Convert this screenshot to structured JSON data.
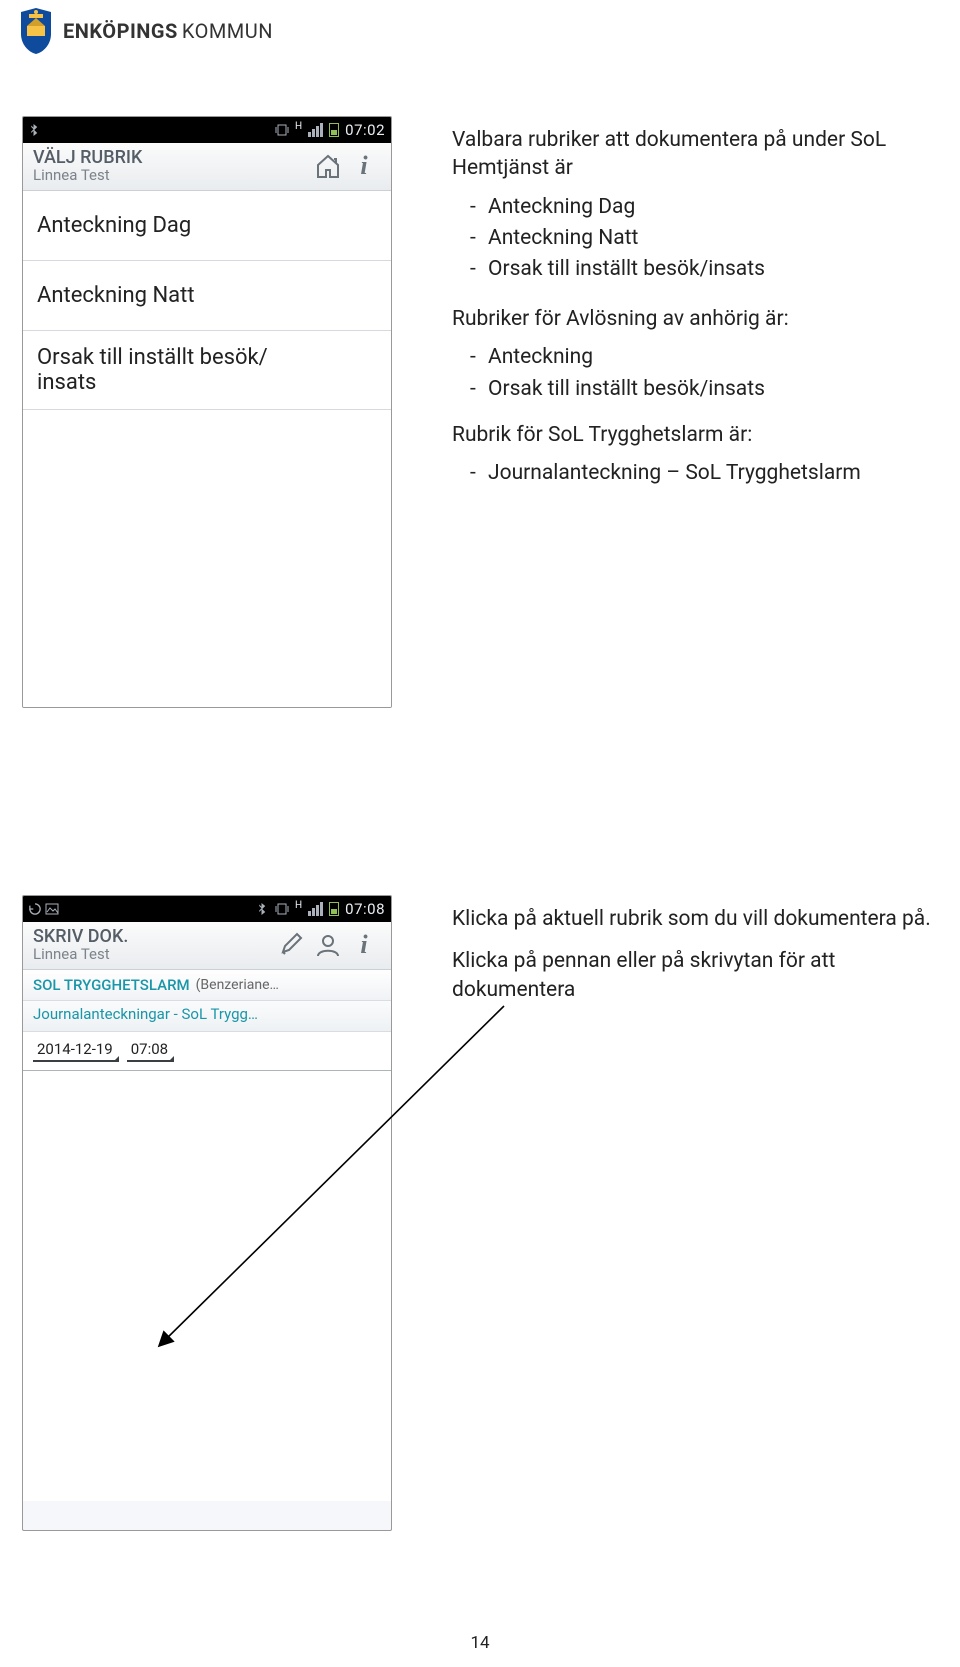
{
  "logo": {
    "text_first": "ENKÖPINGS",
    "text_second": "KOMMUN"
  },
  "phone1": {
    "status_time": "07:02",
    "net_label": "H",
    "title": "VÄLJ RUBRIK",
    "subtitle": "Linnea Test",
    "rows": {
      "r1": "Anteckning Dag",
      "r2": "Anteckning Natt",
      "r3a": "Orsak till inställt besök/",
      "r3b": "insats"
    }
  },
  "phone2": {
    "status_time": "07:08",
    "net_label": "H",
    "title": "SKRIV DOK.",
    "subtitle": "Linnea Test",
    "docname": "SOL TRYGGHETSLARM",
    "docparen": "(Benzeriane…",
    "docline": "Journalanteckningar - SoL Trygg…",
    "date": "2014-12-19",
    "time": "07:08"
  },
  "rtext1": {
    "head": "Valbara rubriker att dokumentera på under SoL Hemtjänst är",
    "items": [
      "Anteckning Dag",
      "Anteckning Natt",
      "Orsak till inställt besök/insats"
    ]
  },
  "rtext2": {
    "headA": "Rubriker för Avlösning av anhörig är:",
    "itemsA": [
      "Anteckning",
      "Orsak till inställt besök/insats"
    ],
    "headB": "Rubrik för SoL Trygghetslarm är:",
    "itemsB": [
      "Journalanteckning – SoL Trygghetslarm"
    ]
  },
  "rtext3": {
    "p1": "Klicka på aktuell rubrik som du vill dokumentera på.",
    "p2": "Klicka på pennan eller på skrivytan för att dokumentera"
  },
  "pagenum": "14"
}
